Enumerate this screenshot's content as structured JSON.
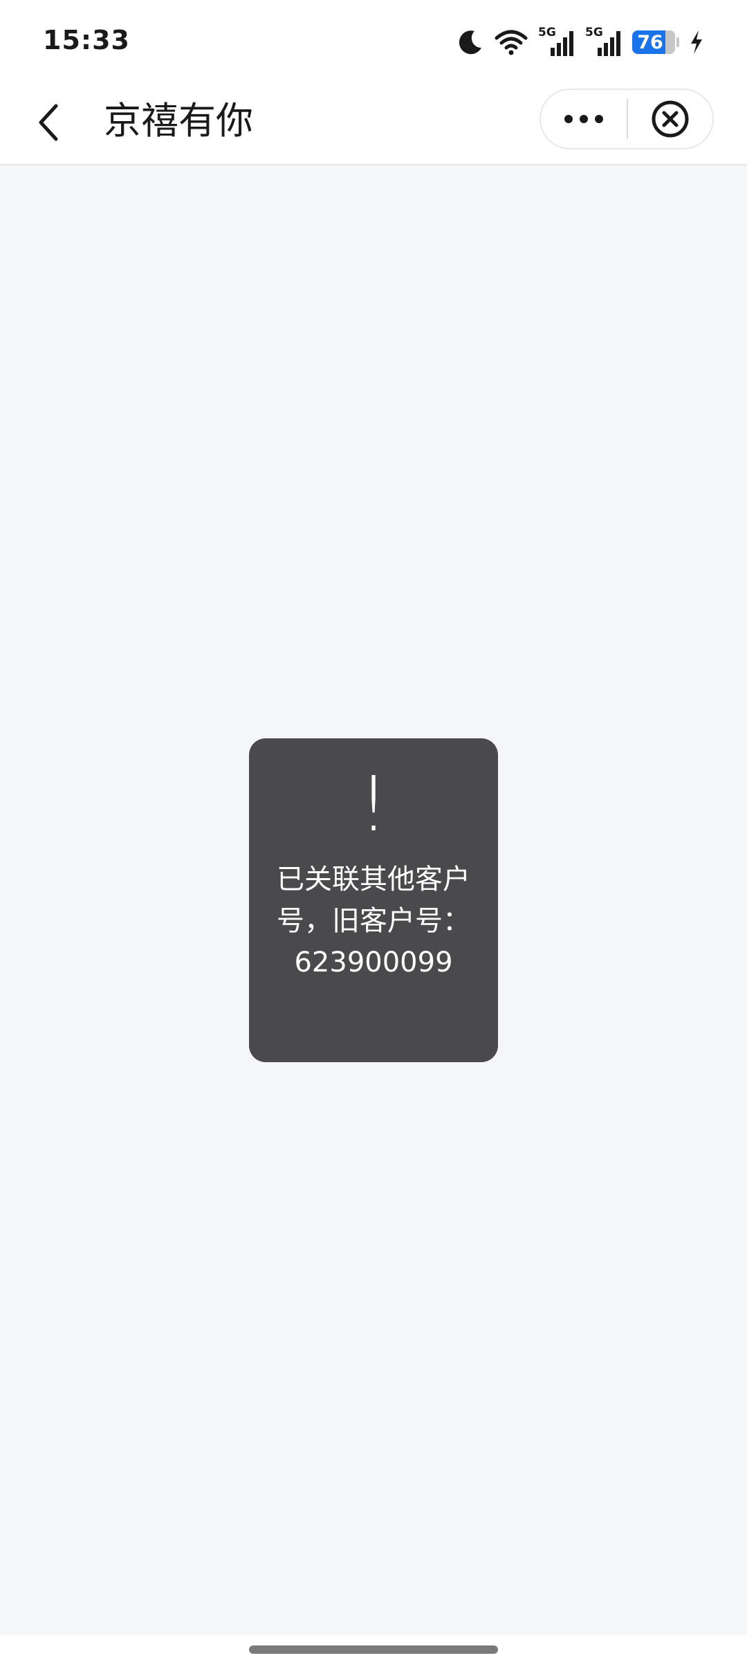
{
  "status_bar": {
    "time": "15:33",
    "battery_level": "76",
    "icons": [
      "moon-icon",
      "wifi-icon",
      "signal-5g-icon",
      "signal-5g-icon",
      "battery-icon",
      "charging-icon"
    ],
    "network_label_1": "5G",
    "network_label_2": "5G"
  },
  "nav": {
    "title": "京禧有你",
    "back_icon": "chevron-left-icon",
    "more_icon": "more-dots-icon",
    "close_icon": "close-circle-icon"
  },
  "toast": {
    "icon_glyph": "!",
    "message": "已关联其他客户号，旧客户号：623900099"
  },
  "colors": {
    "page_bg": "#f5f6fa",
    "toast_bg": "#4a4a4c",
    "battery_accent": "#1a73e8"
  }
}
